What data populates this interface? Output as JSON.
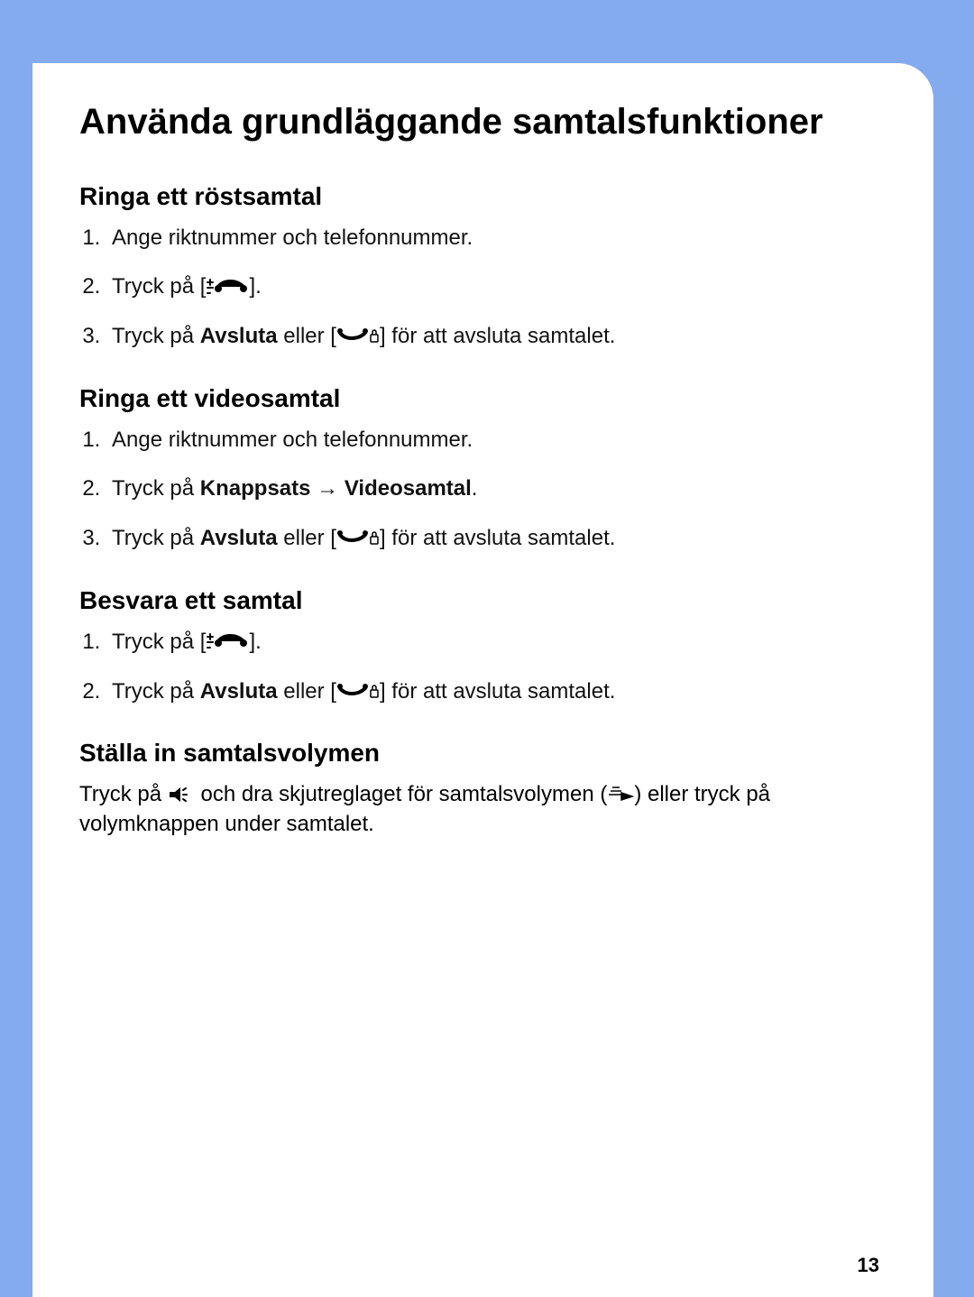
{
  "title": "Använda grundläggande samtalsfunktioner",
  "page_number": "13",
  "sections": {
    "voice_call": {
      "heading": "Ringa ett röstsamtal",
      "step1": "Ange riktnummer och telefonnummer.",
      "step2_pre": "Tryck på [",
      "step2_post": "].",
      "step3_pre": "Tryck på ",
      "step3_bold": "Avsluta",
      "step3_mid": " eller [",
      "step3_post": "] för att avsluta samtalet."
    },
    "video_call": {
      "heading": "Ringa ett videosamtal",
      "step1": "Ange riktnummer och telefonnummer.",
      "step2_pre": "Tryck på ",
      "step2_bold1": "Knappsats",
      "step2_arrow": " → ",
      "step2_bold2": "Videosamtal",
      "step2_post": ".",
      "step3_pre": "Tryck på ",
      "step3_bold": "Avsluta",
      "step3_mid": " eller [",
      "step3_post": "] för att avsluta samtalet."
    },
    "answer_call": {
      "heading": "Besvara ett samtal",
      "step1_pre": "Tryck på [",
      "step1_post": "].",
      "step2_pre": "Tryck på ",
      "step2_bold": "Avsluta",
      "step2_mid": " eller [",
      "step2_post": "] för att avsluta samtalet."
    },
    "volume": {
      "heading": "Ställa in samtalsvolymen",
      "text_pre": "Tryck på ",
      "text_mid": " och dra skjutreglaget för samtalsvolymen (",
      "text_post": ") eller tryck på volymknappen under samtalet."
    }
  }
}
